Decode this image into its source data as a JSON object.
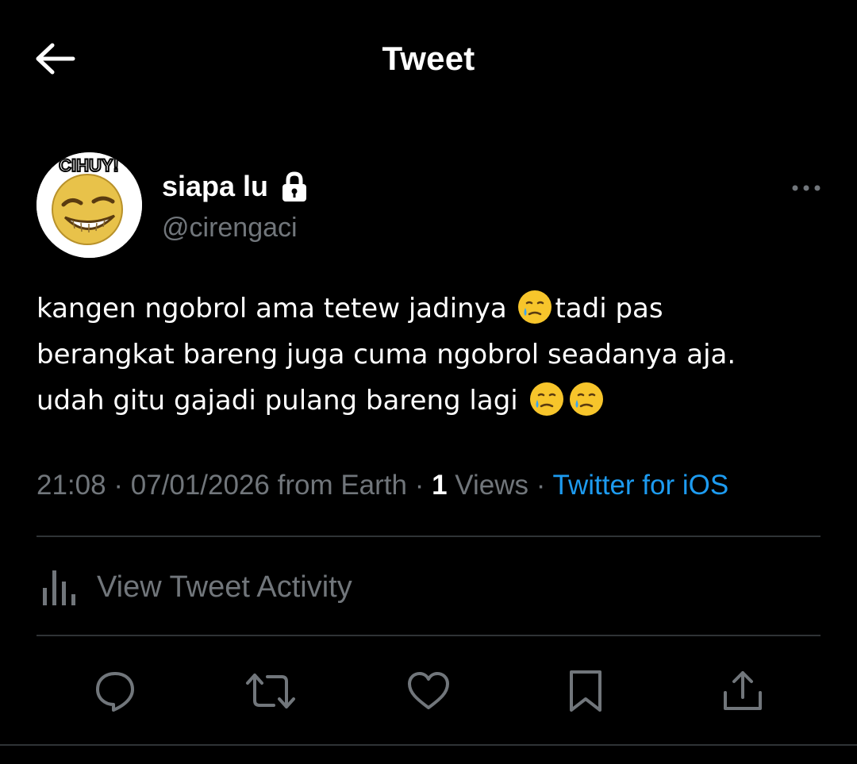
{
  "header": {
    "title": "Tweet",
    "back_icon": "arrow-left-icon"
  },
  "author": {
    "display_name": "siapa lu",
    "handle": "@cirengaci",
    "avatar_text": "CIHUY!",
    "protected_icon": "lock-icon",
    "more_icon": "more-horizontal-icon"
  },
  "tweet": {
    "lines": [
      [
        "kangen ngobrol ama tetew jadinya ",
        "tadi pas"
      ],
      [
        "berangkat bareng juga cuma ngobrol seadanya aja."
      ],
      [
        "udah gitu gajadi pulang bareng lagi "
      ]
    ],
    "emoji": "face-holding-back-tears-icon"
  },
  "meta": {
    "time": "21:08",
    "separator": " · ",
    "date": "07/01/2026",
    "location": " from Earth",
    "views_count": "1",
    "views_label": " Views",
    "source": "Twitter for iOS"
  },
  "activity": {
    "label": "View Tweet Activity",
    "icon": "analytics-icon"
  },
  "actions": [
    {
      "name": "reply-button",
      "icon": "reply-icon"
    },
    {
      "name": "retweet-button",
      "icon": "retweet-icon"
    },
    {
      "name": "like-button",
      "icon": "heart-icon"
    },
    {
      "name": "bookmark-button",
      "icon": "bookmark-icon"
    },
    {
      "name": "share-button",
      "icon": "share-icon"
    }
  ],
  "colors": {
    "background": "#000000",
    "text_primary": "#ffffff",
    "text_secondary": "#71767b",
    "accent": "#1d9bf0",
    "divider": "#2f3336"
  }
}
